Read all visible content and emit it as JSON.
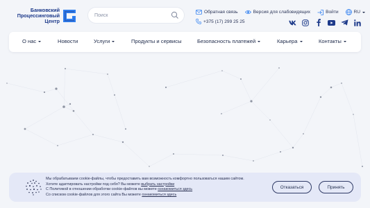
{
  "brand": {
    "line1": "Банковский",
    "line2": "Процессинговый",
    "line3": "Центр",
    "color": "#1d3a8a",
    "accent": "#2f7ff0"
  },
  "search": {
    "placeholder": "Поиск"
  },
  "top_links": {
    "feedback": "Обратная связь",
    "accessibility": "Версия для слабовидящих",
    "login": "Войти",
    "language": "RU",
    "phone": "+375 (17) 299 25 25"
  },
  "socials": [
    "vk-icon",
    "instagram-icon",
    "facebook-icon",
    "youtube-icon",
    "telegram-icon",
    "linkedin-icon"
  ],
  "nav": [
    {
      "label": "О нас",
      "dropdown": true
    },
    {
      "label": "Новости",
      "dropdown": false
    },
    {
      "label": "Услуги",
      "dropdown": true
    },
    {
      "label": "Продукты и сервисы",
      "dropdown": false
    },
    {
      "label": "Безопасность платежей",
      "dropdown": true
    },
    {
      "label": "Карьера",
      "dropdown": true
    },
    {
      "label": "Контакты",
      "dropdown": true
    }
  ],
  "cookie": {
    "line1": "Мы обрабатываем cookie-файлы, чтобы предоставить вам возможность комфортно пользоваться нашим сайтом.",
    "line2_prefix": "Хотите адаптировать настройки под себя? Вы можете ",
    "line2_link": "выбрать настройки",
    "line3_prefix": "С Политикой в отношении обработки cookie-файлов вы можете ",
    "line3_link": "ознакомиться здесь",
    "line4_prefix": "Со списком cookie-файлов для этого сайта Вы можете ",
    "line4_link": "ознакомиться здесь",
    "decline": "Отказаться",
    "accept": "Принять"
  }
}
